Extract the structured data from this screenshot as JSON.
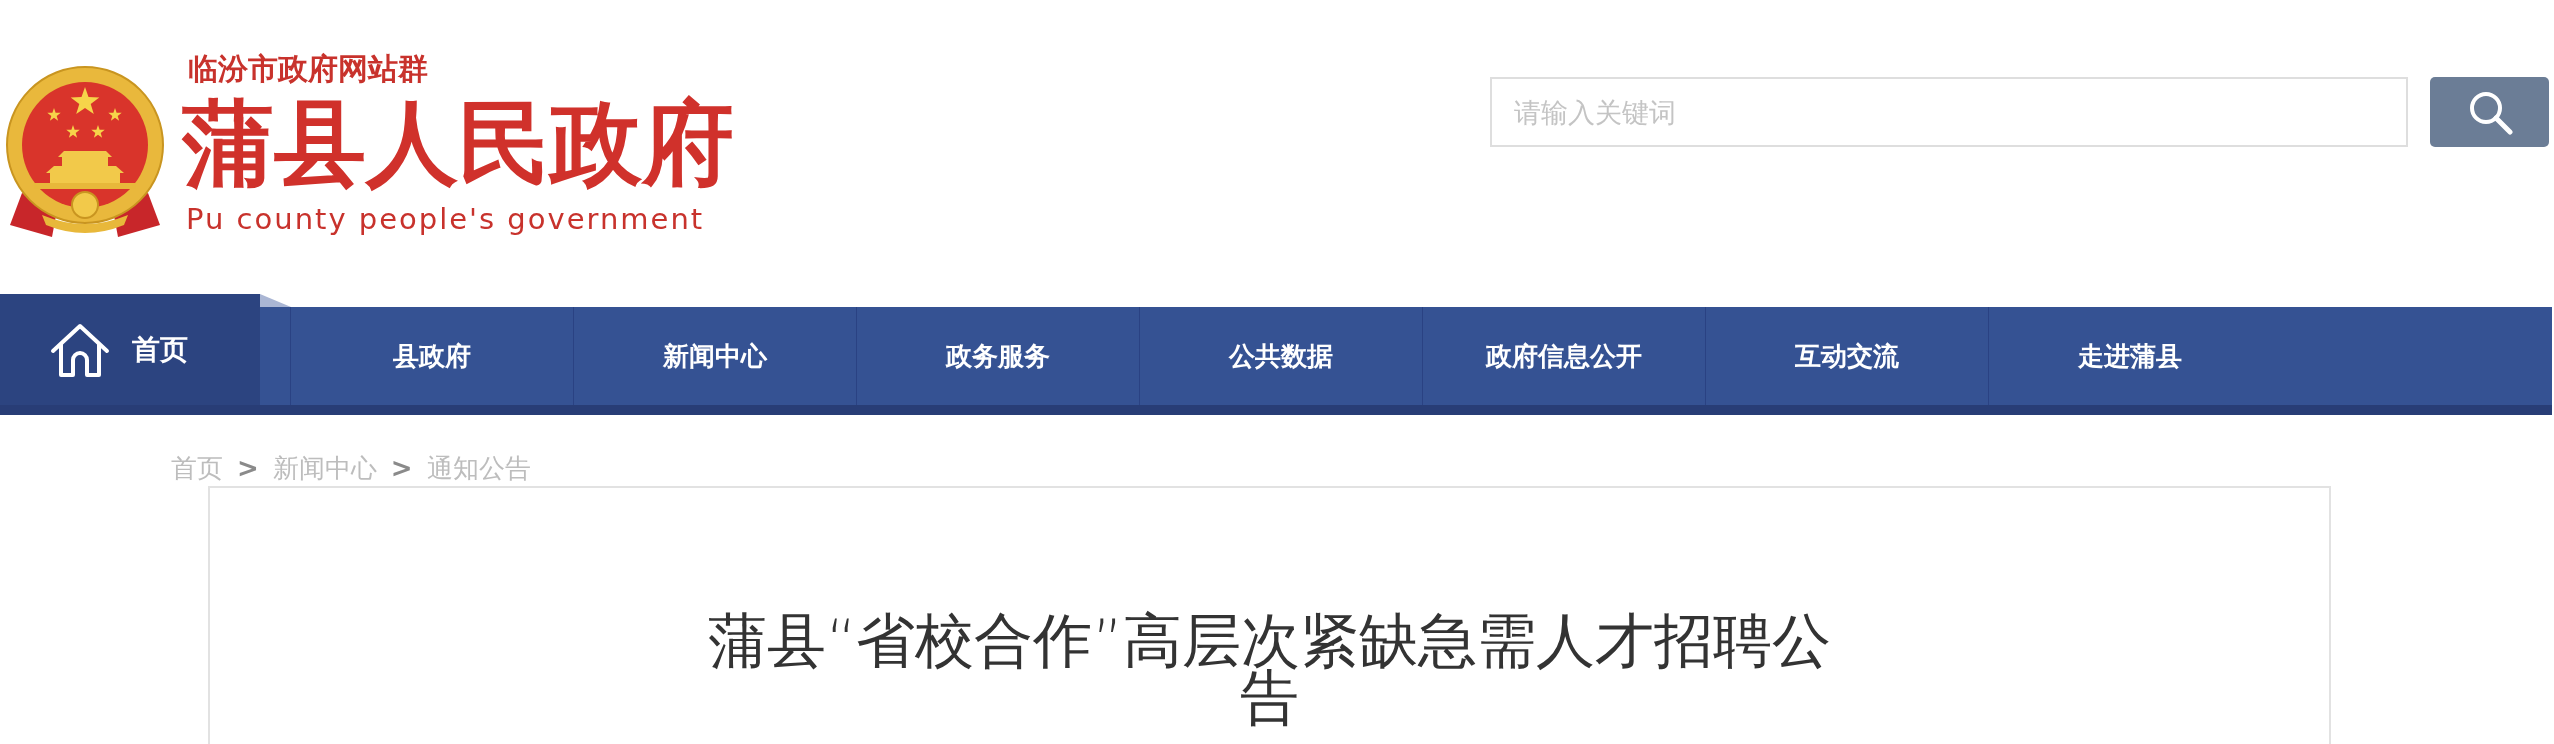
{
  "header": {
    "site_group": "临汾市政府网站群",
    "site_name": "蒲县人民政府",
    "site_name_en": "Pu county people's government",
    "search": {
      "placeholder": "请输入关键词"
    }
  },
  "nav": [
    {
      "label": "首页",
      "kind": "home",
      "selected": true
    },
    {
      "label": "县政府",
      "kind": "link",
      "selected": false
    },
    {
      "label": "新闻中心",
      "kind": "link",
      "selected": false
    },
    {
      "label": "政务服务",
      "kind": "link",
      "selected": false
    },
    {
      "label": "公共数据",
      "kind": "link",
      "selected": false
    },
    {
      "label": "政府信息公开",
      "kind": "link",
      "selected": false
    },
    {
      "label": "互动交流",
      "kind": "link",
      "selected": false
    },
    {
      "label": "走进蒲县",
      "kind": "link",
      "selected": false
    }
  ],
  "breadcrumb": [
    {
      "label": "首页",
      "separator": ">"
    },
    {
      "label": "新闻中心",
      "separator": ">"
    },
    {
      "label": "通知公告"
    }
  ],
  "article": {
    "title": "蒲县“省校合作”高层次紧缺急需人才招聘公告"
  }
}
